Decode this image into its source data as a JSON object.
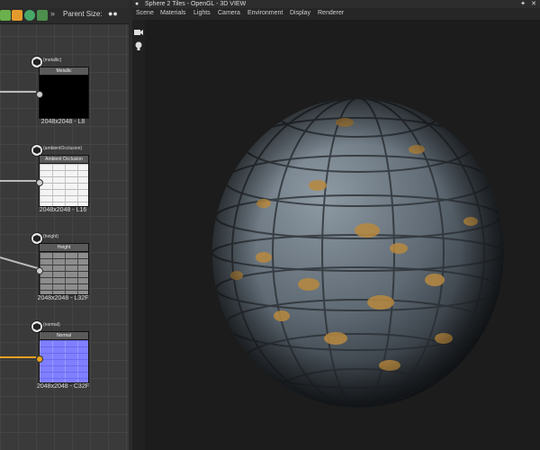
{
  "graph": {
    "toolbar": {
      "parent_size_label": "Parent Size:",
      "expand_icon": "»",
      "link_icon": "link-icon"
    },
    "nodes": [
      {
        "tag": "(metallic)",
        "header": "Metallic",
        "caption": "2048x2048 - L8",
        "thumb": "black"
      },
      {
        "tag": "(ambientOcclusion)",
        "header": "Ambient Occlusion",
        "caption": "2048x2048 - L16",
        "thumb": "white-bricks"
      },
      {
        "tag": "(height)",
        "header": "Height",
        "caption": "2048x2048 - L32F",
        "thumb": "gray-bricks"
      },
      {
        "tag": "(normal)",
        "header": "Normal",
        "caption": "2048x2048 - C32F",
        "thumb": "normal-blue"
      }
    ]
  },
  "view": {
    "title": "Sphere 2 Tiles - OpenGL - 3D VIEW",
    "menu": [
      "Scene",
      "Materials",
      "Lights",
      "Camera",
      "Environment",
      "Display",
      "Renderer"
    ],
    "sidebar_icons": [
      "camera-icon",
      "light-icon"
    ]
  },
  "colors": {
    "accent_wire": "#e7a11e",
    "grout": "#b8893f",
    "tile": "#6f7a84"
  }
}
